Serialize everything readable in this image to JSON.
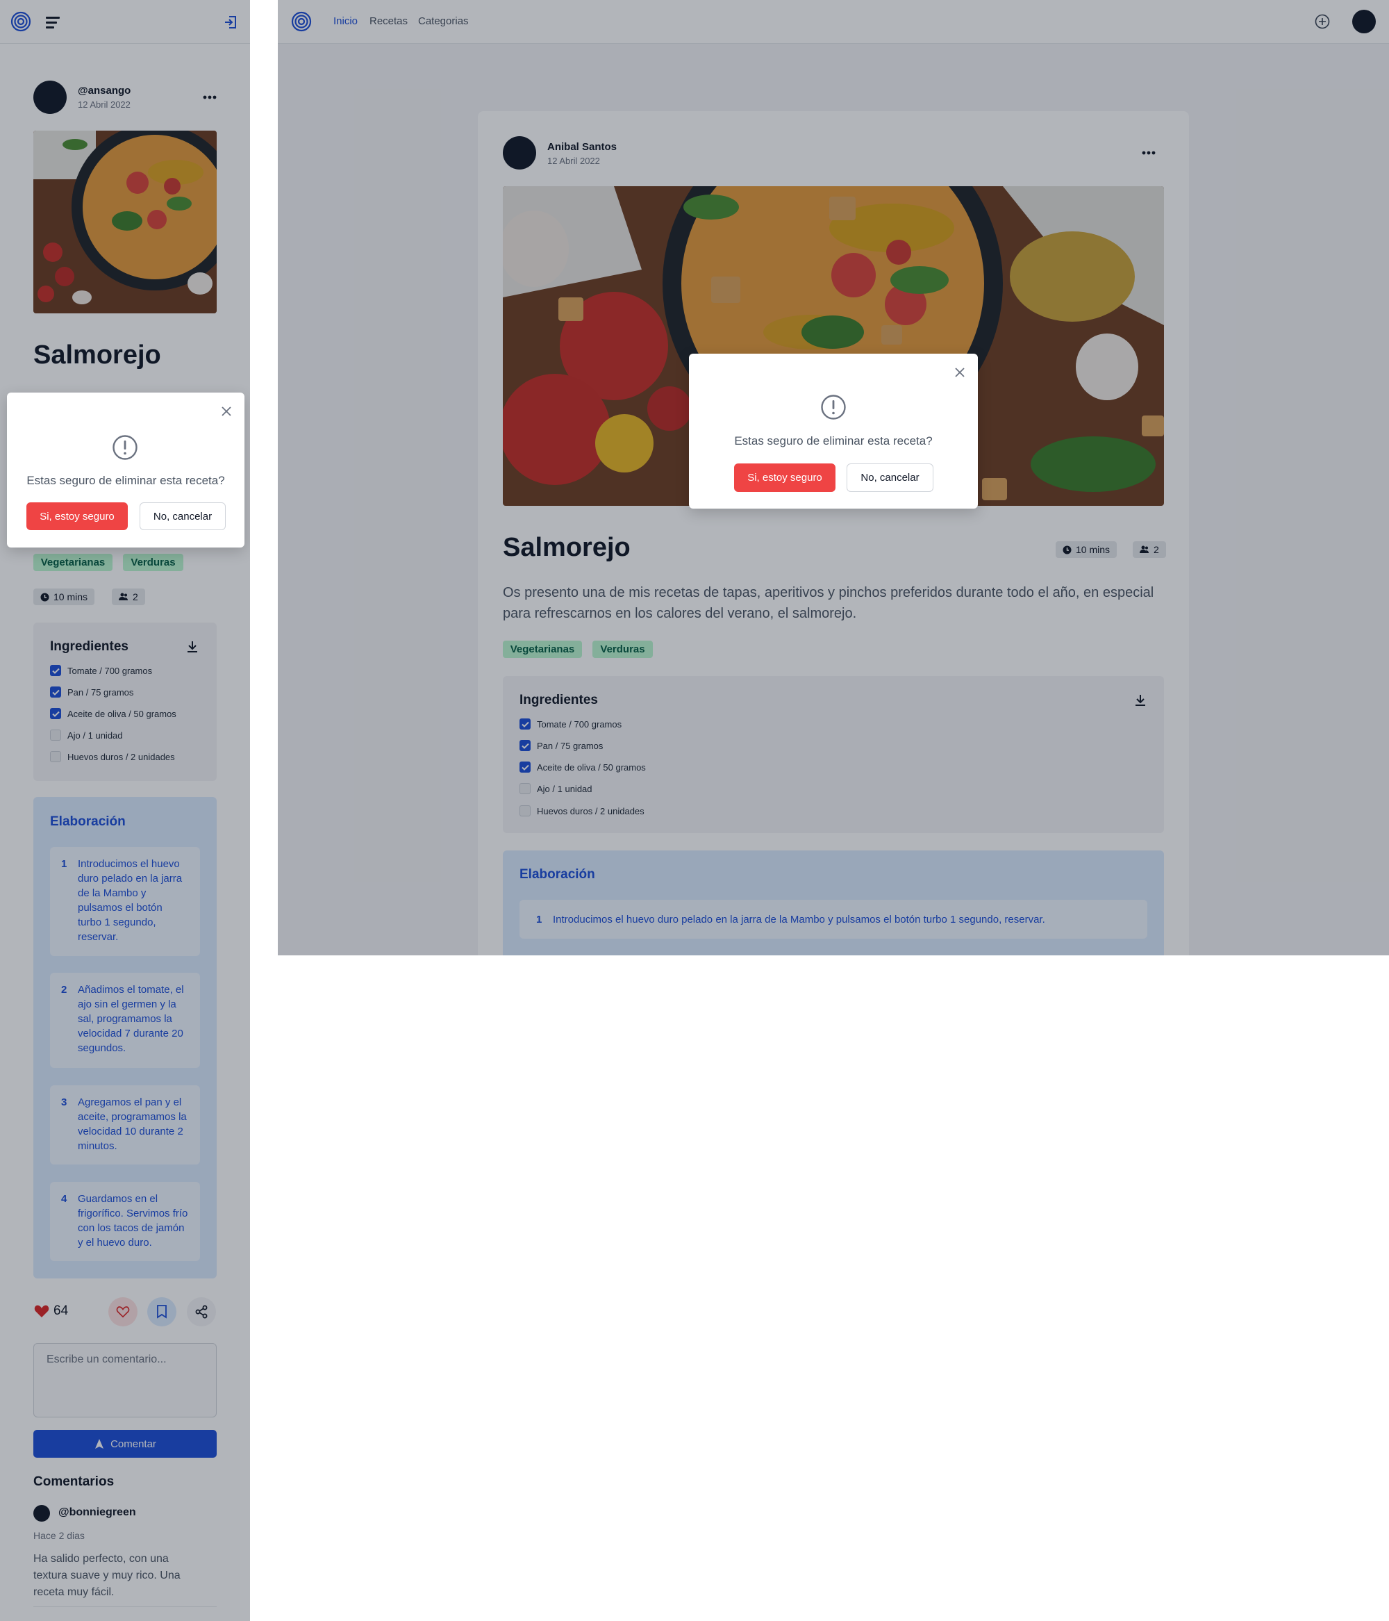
{
  "mobile": {
    "header": {
      "logo_icon": "logo-icon",
      "menu_icon": "menu-icon",
      "logout_icon": "logout-icon"
    },
    "post": {
      "username": "@ansango",
      "date": "12 Abril 2022",
      "title": "Salmorejo",
      "tags": [
        "Vegetarianas",
        "Verduras"
      ],
      "time": "10 mins",
      "servings": "2",
      "ingredients_title": "Ingredientes",
      "ingredients": [
        {
          "label": "Tomate / 700 gramos",
          "checked": true
        },
        {
          "label": "Pan / 75 gramos",
          "checked": true
        },
        {
          "label": "Aceite de oliva / 50 gramos",
          "checked": true
        },
        {
          "label": "Ajo / 1 unidad",
          "checked": false
        },
        {
          "label": "Huevos duros / 2 unidades",
          "checked": false
        }
      ],
      "steps_title": "Elaboración",
      "steps": [
        {
          "n": "1",
          "text": "Introducimos el huevo duro pelado en la jarra de la Mambo y pulsamos el botón turbo 1 segundo, reservar."
        },
        {
          "n": "2",
          "text": "Añadimos el tomate, el ajo sin el germen y la sal, programamos la velocidad 7 durante 20 segundos."
        },
        {
          "n": "3",
          "text": "Agregamos el pan y el aceite, programamos la velocidad 10 durante 2 minutos."
        },
        {
          "n": "4",
          "text": "Guardamos en el frigorífico. Servimos frío con los tacos de jamón y el huevo duro."
        }
      ],
      "likes": "64",
      "comment_placeholder": "Escribe un comentario...",
      "comment_button": "Comentar",
      "comments_title": "Comentarios",
      "comments": [
        {
          "user": "@bonniegreen",
          "time": "Hace 2 dias",
          "text": "Ha salido perfecto, con una textura suave y muy rico. Una receta muy fácil."
        }
      ]
    },
    "modal": {
      "message": "Estas seguro de eliminar esta receta?",
      "confirm": "Si, estoy seguro",
      "cancel": "No, cancelar"
    }
  },
  "desktop": {
    "nav": {
      "items": [
        "Inicio",
        "Recetas",
        "Categorias"
      ],
      "active": "Inicio"
    },
    "post": {
      "author": "Anibal Santos",
      "date": "12 Abril 2022",
      "title": "Salmorejo",
      "time": "10 mins",
      "servings": "2",
      "description": "Os presento una de mis recetas de tapas, aperitivos y pinchos preferidos durante todo el año, en especial para refrescarnos en los calores del verano, el salmorejo.",
      "tags": [
        "Vegetarianas",
        "Verduras"
      ],
      "ingredients_title": "Ingredientes",
      "ingredients": [
        {
          "label": "Tomate / 700 gramos",
          "checked": true
        },
        {
          "label": "Pan / 75 gramos",
          "checked": true
        },
        {
          "label": "Aceite de oliva / 50 gramos",
          "checked": true
        },
        {
          "label": "Ajo / 1 unidad",
          "checked": false
        },
        {
          "label": "Huevos duros / 2 unidades",
          "checked": false
        }
      ],
      "steps_title": "Elaboración",
      "steps": [
        {
          "n": "1",
          "text": "Introducimos el huevo duro pelado en la jarra de la Mambo y pulsamos el botón turbo 1 segundo, reservar."
        }
      ]
    },
    "modal": {
      "message": "Estas seguro de eliminar esta receta?",
      "confirm": "Si, estoy seguro",
      "cancel": "No, cancelar"
    }
  },
  "colors": {
    "accent": "#1d4ed8",
    "danger": "#ef4444",
    "tag_bg": "#bbf7d0",
    "tag_text": "#065f46"
  }
}
